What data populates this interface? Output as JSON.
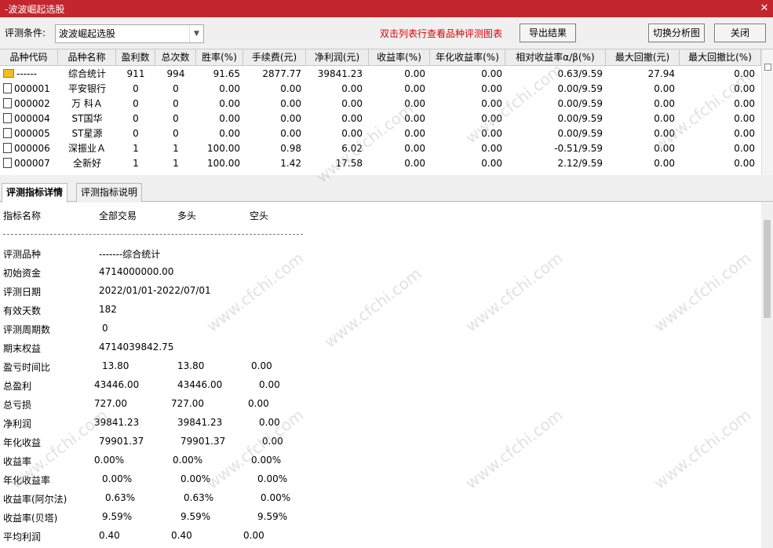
{
  "window": {
    "title": "-波波崛起选股"
  },
  "toolbar": {
    "condition_label": "评测条件:",
    "condition_value": "波波崛起选股",
    "hint": "双击列表行查看品种评测图表",
    "export_label": "导出结果",
    "switch_label": "切换分析图",
    "close_label": "关闭"
  },
  "table": {
    "columns": [
      "品种代码",
      "品种名称",
      "盈利数",
      "总次数",
      "胜率(%)",
      "手续费(元)",
      "净利润(元)",
      "收益率(%)",
      "年化收益率(%)",
      "相对收益率α/β(%)",
      "最大回撤(元)",
      "最大回撤比(%)"
    ],
    "rows": [
      {
        "icon": "summary-icon",
        "code": "------",
        "name": "综合统计",
        "win": "911",
        "total": "994",
        "rate": "91.65",
        "fee": "2877.77",
        "profit": "39841.23",
        "ret": "0.00",
        "annual": "0.00",
        "rel": "0.63/9.59",
        "maxdd": "27.94",
        "ddratio": "0.00"
      },
      {
        "icon": "document-icon",
        "code": "000001",
        "name": "平安银行",
        "win": "0",
        "total": "0",
        "rate": "0.00",
        "fee": "0.00",
        "profit": "0.00",
        "ret": "0.00",
        "annual": "0.00",
        "rel": "0.00/9.59",
        "maxdd": "0.00",
        "ddratio": "0.00"
      },
      {
        "icon": "document-icon",
        "code": "000002",
        "name": "万 科Ａ",
        "win": "0",
        "total": "0",
        "rate": "0.00",
        "fee": "0.00",
        "profit": "0.00",
        "ret": "0.00",
        "annual": "0.00",
        "rel": "0.00/9.59",
        "maxdd": "0.00",
        "ddratio": "0.00"
      },
      {
        "icon": "document-icon",
        "code": "000004",
        "name": "ST国华",
        "win": "0",
        "total": "0",
        "rate": "0.00",
        "fee": "0.00",
        "profit": "0.00",
        "ret": "0.00",
        "annual": "0.00",
        "rel": "0.00/9.59",
        "maxdd": "0.00",
        "ddratio": "0.00"
      },
      {
        "icon": "document-icon",
        "code": "000005",
        "name": "ST星源",
        "win": "0",
        "total": "0",
        "rate": "0.00",
        "fee": "0.00",
        "profit": "0.00",
        "ret": "0.00",
        "annual": "0.00",
        "rel": "0.00/9.59",
        "maxdd": "0.00",
        "ddratio": "0.00"
      },
      {
        "icon": "document-icon",
        "code": "000006",
        "name": "深振业Ａ",
        "win": "1",
        "total": "1",
        "rate": "100.00",
        "fee": "0.98",
        "profit": "6.02",
        "ret": "0.00",
        "annual": "0.00",
        "rel": "-0.51/9.59",
        "maxdd": "0.00",
        "ddratio": "0.00"
      },
      {
        "icon": "document-icon",
        "code": "000007",
        "name": "全新好",
        "win": "1",
        "total": "1",
        "rate": "100.00",
        "fee": "1.42",
        "profit": "17.58",
        "ret": "0.00",
        "annual": "0.00",
        "rel": "2.12/9.59",
        "maxdd": "0.00",
        "ddratio": "0.00"
      }
    ]
  },
  "tabs": [
    {
      "label": "评测指标详情"
    },
    {
      "label": "评测指标说明"
    }
  ],
  "detail": {
    "headers": [
      "指标名称",
      "全部交易",
      "多头",
      "空头"
    ],
    "rows": [
      {
        "label": "评测品种",
        "v1": "-------综合统计",
        "v2": "",
        "v3": ""
      },
      {
        "label": "初始资金",
        "v1": "4714000000.00",
        "v2": "",
        "v3": ""
      },
      {
        "label": "评测日期",
        "v1": "2022/01/01-2022/07/01",
        "v2": "",
        "v3": ""
      },
      {
        "label": "有效天数",
        "v1": "182",
        "v2": "",
        "v3": ""
      },
      {
        "label": "评测周期数",
        "v1": "0",
        "v2": "",
        "v3": ""
      },
      {
        "label": "期末权益",
        "v1": "4714039842.75",
        "v2": "",
        "v3": ""
      },
      {
        "label": "盈亏时间比",
        "v1": "13.80",
        "v2": "13.80",
        "v3": "0.00"
      },
      {
        "label": "总盈利",
        "v1": "43446.00",
        "v2": "43446.00",
        "v3": "0.00"
      },
      {
        "label": "总亏损",
        "v1": "727.00",
        "v2": "727.00",
        "v3": "0.00"
      },
      {
        "label": "净利润",
        "v1": "39841.23",
        "v2": "39841.23",
        "v3": "0.00"
      },
      {
        "label": "年化收益",
        "v1": "79901.37",
        "v2": "79901.37",
        "v3": "0.00"
      },
      {
        "label": "收益率",
        "v1": "0.00%",
        "v2": "0.00%",
        "v3": "0.00%"
      },
      {
        "label": "年化收益率",
        "v1": "0.00%",
        "v2": "0.00%",
        "v3": "0.00%"
      },
      {
        "label": "收益率(阿尔法)",
        "v1": "0.63%",
        "v2": "0.63%",
        "v3": "0.00%"
      },
      {
        "label": "收益率(贝塔)",
        "v1": "9.59%",
        "v2": "9.59%",
        "v3": "9.59%"
      },
      {
        "label": "平均利润",
        "v1": "0.40",
        "v2": "0.40",
        "v3": "0.00"
      }
    ]
  },
  "watermark": "www.cfchi.com",
  "colors": {
    "titlebar": "#c3262e",
    "hint": "#e00000"
  }
}
